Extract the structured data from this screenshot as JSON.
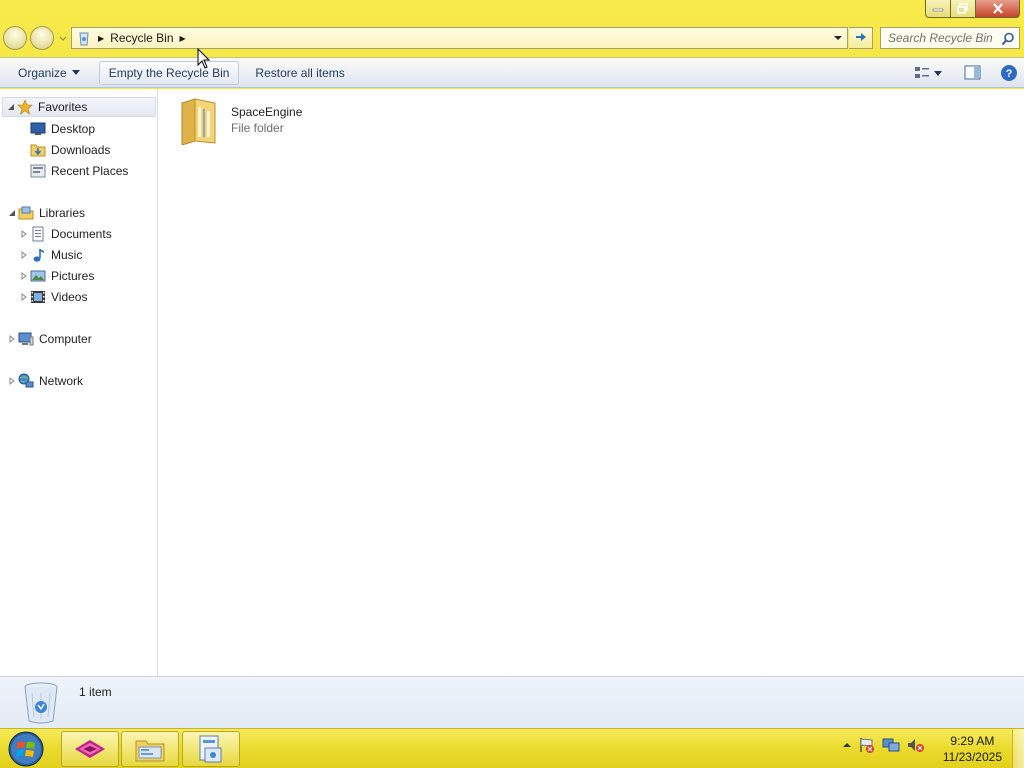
{
  "window": {
    "caption_buttons": [
      "minimize",
      "maximize",
      "close"
    ]
  },
  "address_bar": {
    "location_icon": "recycle-bin-icon",
    "breadcrumb": "Recycle Bin",
    "search_placeholder": "Search Recycle Bin"
  },
  "command_bar": {
    "organize": "Organize",
    "empty": "Empty the Recycle Bin",
    "restore": "Restore all items",
    "right_icons": [
      "change-view-icon",
      "preview-pane-icon",
      "help-icon"
    ]
  },
  "nav_pane": {
    "favorites": "Favorites",
    "favorites_items": [
      "Desktop",
      "Downloads",
      "Recent Places"
    ],
    "libraries": "Libraries",
    "libraries_items": [
      "Documents",
      "Music",
      "Pictures",
      "Videos"
    ],
    "computer": "Computer",
    "network": "Network"
  },
  "content": {
    "items": [
      {
        "name": "SpaceEngine",
        "type": "File folder",
        "icon": "folder-icon"
      }
    ]
  },
  "details_pane": {
    "count": "1 item"
  },
  "taskbar": {
    "pinned": [
      "app-icon",
      "explorer-icon",
      "recycle-window-icon"
    ],
    "tray_icons": [
      "tray-arrow-icon",
      "action-center-icon",
      "network-icon",
      "volume-muted-icon"
    ],
    "time": "9:29 AM",
    "date": "11/23/2025"
  },
  "colors": {
    "frame": "#f3e236",
    "taskbar": "#eadb2c",
    "text": "#1e395b"
  }
}
